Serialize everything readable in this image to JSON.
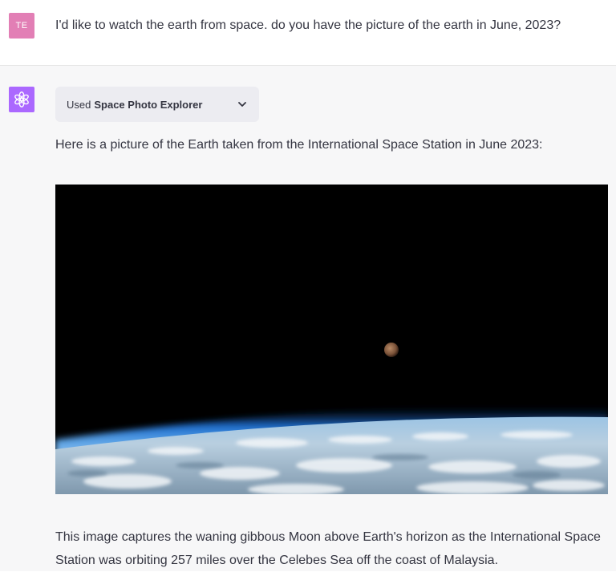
{
  "user": {
    "avatar_initials": "TE",
    "message": "I'd like to watch the earth from space. do you have the picture of the earth in June, 2023?"
  },
  "assistant": {
    "plugin": {
      "prefix": "Used",
      "name": "Space Photo Explorer"
    },
    "intro": "Here is a picture of the Earth taken from the International Space Station in June 2023:",
    "photo": {
      "subject": "waning gibbous Moon above Earth's horizon"
    },
    "caption": "This image captures the waning gibbous Moon above Earth's horizon as the International Space Station was orbiting 257 miles over the Celebes Sea off the coast of Malaysia."
  },
  "colors": {
    "user_avatar": "#e27fb5",
    "bot_avatar": "#ab68ff",
    "assistant_bg": "#f7f7f8",
    "pill_bg": "#ececf1",
    "text": "#343541"
  },
  "icons": {
    "bot": "openai-logo-icon",
    "plugin_toggle": "chevron-down-icon"
  }
}
